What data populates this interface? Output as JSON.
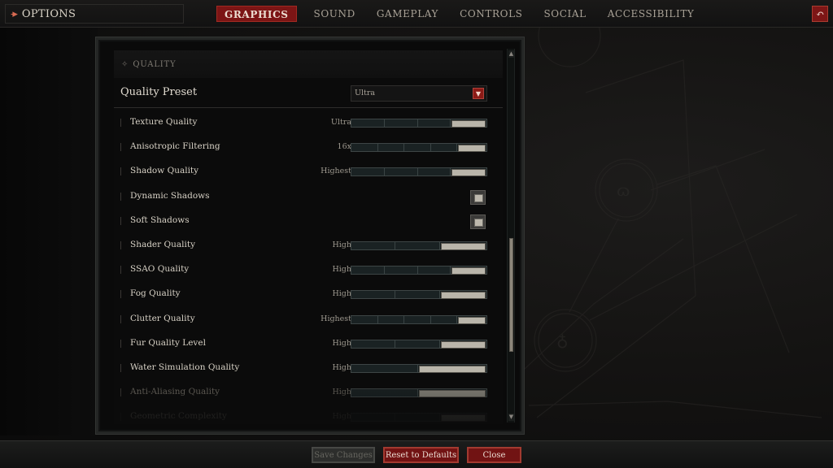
{
  "header": {
    "title": "OPTIONS",
    "options_icon": "arrow-right-icon",
    "back_icon": "undo-arrow-icon",
    "back_glyph": "↶",
    "tabs": [
      {
        "label": "GRAPHICS",
        "active": true
      },
      {
        "label": "SOUND",
        "active": false
      },
      {
        "label": "GAMEPLAY",
        "active": false
      },
      {
        "label": "CONTROLS",
        "active": false
      },
      {
        "label": "SOCIAL",
        "active": false
      },
      {
        "label": "ACCESSIBILITY",
        "active": false
      }
    ]
  },
  "section": {
    "title": "QUALITY",
    "icon": "diamond-sparkle-icon"
  },
  "preset": {
    "label": "Quality Preset",
    "value": "Ultra",
    "arrow_icon": "chevron-down-icon"
  },
  "settings": [
    {
      "label": "Texture Quality",
      "type": "slider",
      "value": "Ultra",
      "steps": 4,
      "selected": 4
    },
    {
      "label": "Anisotropic Filtering",
      "type": "slider",
      "value": "16x",
      "steps": 5,
      "selected": 5
    },
    {
      "label": "Shadow Quality",
      "type": "slider",
      "value": "Highest",
      "steps": 4,
      "selected": 4
    },
    {
      "label": "Dynamic Shadows",
      "type": "checkbox",
      "checked": true
    },
    {
      "label": "Soft Shadows",
      "type": "checkbox",
      "checked": true
    },
    {
      "label": "Shader Quality",
      "type": "slider",
      "value": "High",
      "steps": 3,
      "selected": 3
    },
    {
      "label": "SSAO Quality",
      "type": "slider",
      "value": "High",
      "steps": 4,
      "selected": 4
    },
    {
      "label": "Fog Quality",
      "type": "slider",
      "value": "High",
      "steps": 3,
      "selected": 3
    },
    {
      "label": "Clutter Quality",
      "type": "slider",
      "value": "Highest",
      "steps": 5,
      "selected": 5
    },
    {
      "label": "Fur Quality Level",
      "type": "slider",
      "value": "High",
      "steps": 3,
      "selected": 3
    },
    {
      "label": "Water Simulation Quality",
      "type": "slider",
      "value": "High",
      "steps": 2,
      "selected": 2
    },
    {
      "label": "Anti-Aliasing Quality",
      "type": "slider",
      "value": "High",
      "steps": 2,
      "selected": 2,
      "dim": true
    },
    {
      "label": "Geometric Complexity",
      "type": "slider",
      "value": "High",
      "steps": 3,
      "selected": 3,
      "faded": true
    }
  ],
  "scrollbar": {
    "position_fraction": 0.55
  },
  "footer": {
    "save_label": "Save Changes",
    "save_enabled": false,
    "reset_label": "Reset to Defaults",
    "close_label": "Close"
  },
  "colors": {
    "accent_red": "#7c1515",
    "slider_fill": "#b9b5aa"
  }
}
